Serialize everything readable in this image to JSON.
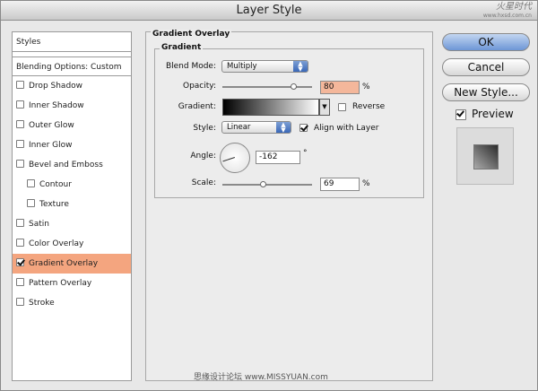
{
  "window": {
    "title": "Layer Style",
    "logo": "火星时代",
    "logo_sub": "www.hxsd.com.cn"
  },
  "styles_panel": {
    "header": "Styles",
    "blending": "Blending Options: Custom",
    "items": [
      {
        "label": "Drop Shadow",
        "checked": false
      },
      {
        "label": "Inner Shadow",
        "checked": false
      },
      {
        "label": "Outer Glow",
        "checked": false
      },
      {
        "label": "Inner Glow",
        "checked": false
      },
      {
        "label": "Bevel and Emboss",
        "checked": false
      },
      {
        "label": "Contour",
        "checked": false
      },
      {
        "label": "Texture",
        "checked": false
      },
      {
        "label": "Satin",
        "checked": false
      },
      {
        "label": "Color Overlay",
        "checked": false
      },
      {
        "label": "Gradient Overlay",
        "checked": true
      },
      {
        "label": "Pattern Overlay",
        "checked": false
      },
      {
        "label": "Stroke",
        "checked": false
      }
    ]
  },
  "gradient_overlay": {
    "group_title": "Gradient Overlay",
    "subgroup_title": "Gradient",
    "blend_mode_label": "Blend Mode:",
    "blend_mode_value": "Multiply",
    "opacity_label": "Opacity:",
    "opacity_value": "80",
    "opacity_unit": "%",
    "opacity_slider": 0.8,
    "gradient_label": "Gradient:",
    "reverse_label": "Reverse",
    "reverse_checked": false,
    "style_label": "Style:",
    "style_value": "Linear",
    "align_label": "Align with Layer",
    "align_checked": true,
    "angle_label": "Angle:",
    "angle_value": "-162",
    "angle_unit": "°",
    "scale_label": "Scale:",
    "scale_value": "69",
    "scale_unit": "%",
    "scale_slider": 0.46
  },
  "buttons": {
    "ok": "OK",
    "cancel": "Cancel",
    "new_style": "New Style...",
    "preview": "Preview",
    "preview_checked": true
  },
  "watermark": "思缘设计论坛  www.MISSYUAN.com"
}
